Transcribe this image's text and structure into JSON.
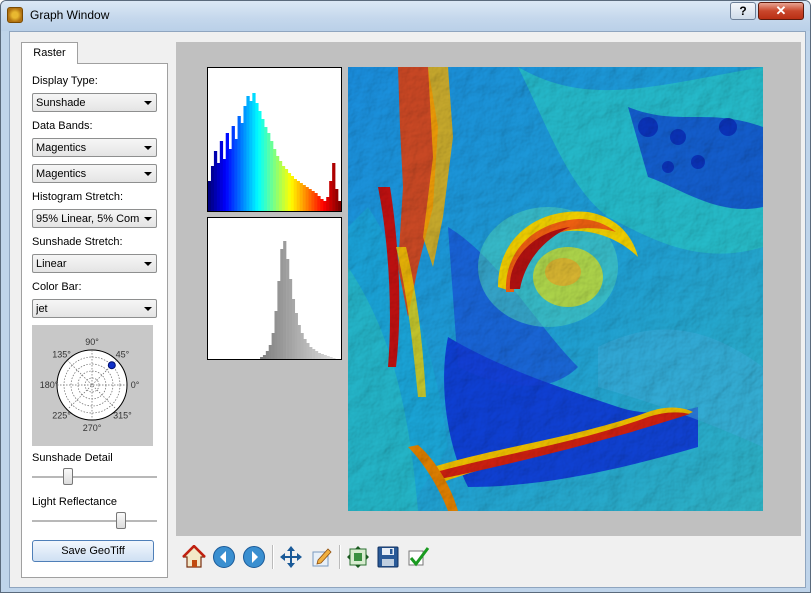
{
  "window": {
    "title": "Graph Window",
    "help_label": "?",
    "close_label": "✕"
  },
  "tab": {
    "label": "Raster"
  },
  "controls": {
    "display_type": {
      "label": "Display Type:",
      "value": "Sunshade"
    },
    "data_bands": {
      "label": "Data Bands:",
      "value1": "Magentics",
      "value2": "Magentics"
    },
    "histogram_stretch": {
      "label": "Histogram Stretch:",
      "value": "95% Linear, 5% Com"
    },
    "sunshade_stretch": {
      "label": "Sunshade Stretch:",
      "value": "Linear"
    },
    "color_bar": {
      "label": "Color Bar:",
      "value": "jet"
    },
    "polar": {
      "labels": [
        "90°",
        "45°",
        "0°",
        "315°",
        "270°",
        "225°",
        "180°",
        "135°"
      ],
      "sun_azimuth_deg": 45,
      "sun_elevation_fraction": 0.8
    },
    "sunshade_detail": {
      "label": "Sunshade Detail",
      "value_fraction": 0.27
    },
    "light_reflectance": {
      "label": "Light Reflectance",
      "value_fraction": 0.73
    },
    "save_button": "Save GeoTiff"
  },
  "toolbar": {
    "icons": [
      "home-icon",
      "back-arrow-icon",
      "forward-arrow-icon",
      "pan-icon",
      "edit-icon",
      "fit-view-icon",
      "save-icon",
      "check-icon"
    ]
  },
  "colors": {
    "accent": "#0a3fa8",
    "canvas_bg": "#c0c0c0"
  }
}
